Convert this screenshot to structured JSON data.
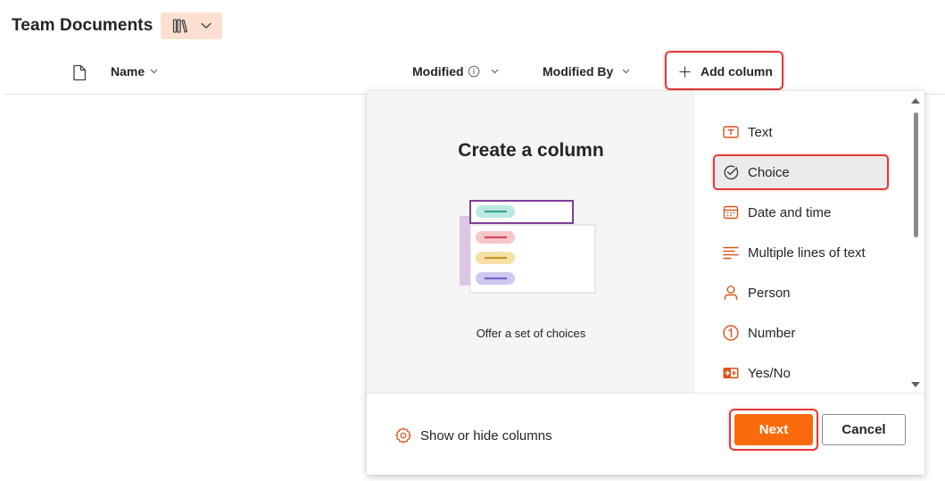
{
  "library": {
    "title": "Team Documents",
    "view_switch_icon": "library-icon",
    "view_switch_chevron": "chevron-down-icon"
  },
  "columns": {
    "name": "Name",
    "modified": "Modified",
    "modified_by": "Modified By",
    "add_column": "Add column"
  },
  "panel": {
    "title": "Create a column",
    "caption": "Offer a set of choices",
    "options": [
      {
        "label": "Text",
        "icon": "text-icon"
      },
      {
        "label": "Choice",
        "icon": "choice-check-icon",
        "selected": true
      },
      {
        "label": "Date and time",
        "icon": "calendar-icon"
      },
      {
        "label": "Multiple lines of text",
        "icon": "multiline-icon"
      },
      {
        "label": "Person",
        "icon": "person-icon"
      },
      {
        "label": "Number",
        "icon": "number-icon"
      },
      {
        "label": "Yes/No",
        "icon": "yes-no-icon"
      }
    ],
    "show_hide": "Show or hide columns",
    "next": "Next",
    "cancel": "Cancel"
  },
  "colors": {
    "accent": "#f86a0b",
    "icon_orange": "#d9541b",
    "highlight": "#e23b3b",
    "view_switch_bg": "#fbe0d2"
  }
}
